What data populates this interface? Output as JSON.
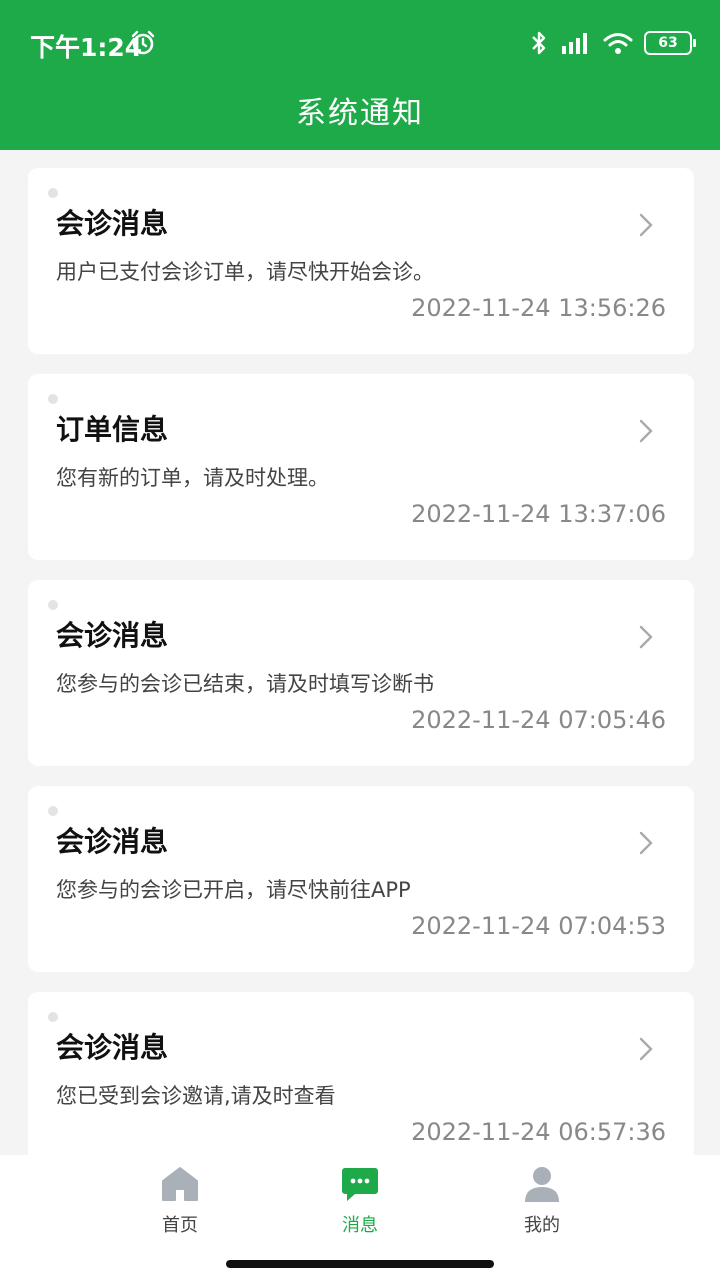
{
  "status_bar": {
    "time": "下午1:24",
    "battery": "63"
  },
  "header": {
    "title": "系统通知"
  },
  "notifications": [
    {
      "title": "会诊消息",
      "body": "用户已支付会诊订单，请尽快开始会诊。",
      "time": "2022-11-24 13:56:26"
    },
    {
      "title": "订单信息",
      "body": "您有新的订单，请及时处理。",
      "time": "2022-11-24 13:37:06"
    },
    {
      "title": "会诊消息",
      "body": "您参与的会诊已结束，请及时填写诊断书",
      "time": "2022-11-24 07:05:46"
    },
    {
      "title": "会诊消息",
      "body": "您参与的会诊已开启，请尽快前往APP",
      "time": "2022-11-24 07:04:53"
    },
    {
      "title": "会诊消息",
      "body": "您已受到会诊邀请,请及时查看",
      "time": "2022-11-24 06:57:36"
    }
  ],
  "tabs": [
    {
      "label": "首页",
      "icon": "home-icon",
      "active": false
    },
    {
      "label": "消息",
      "icon": "message-icon",
      "active": true
    },
    {
      "label": "我的",
      "icon": "user-icon",
      "active": false
    }
  ],
  "colors": {
    "brand": "#1faa49",
    "inactive_icon": "#a9b0b8"
  }
}
